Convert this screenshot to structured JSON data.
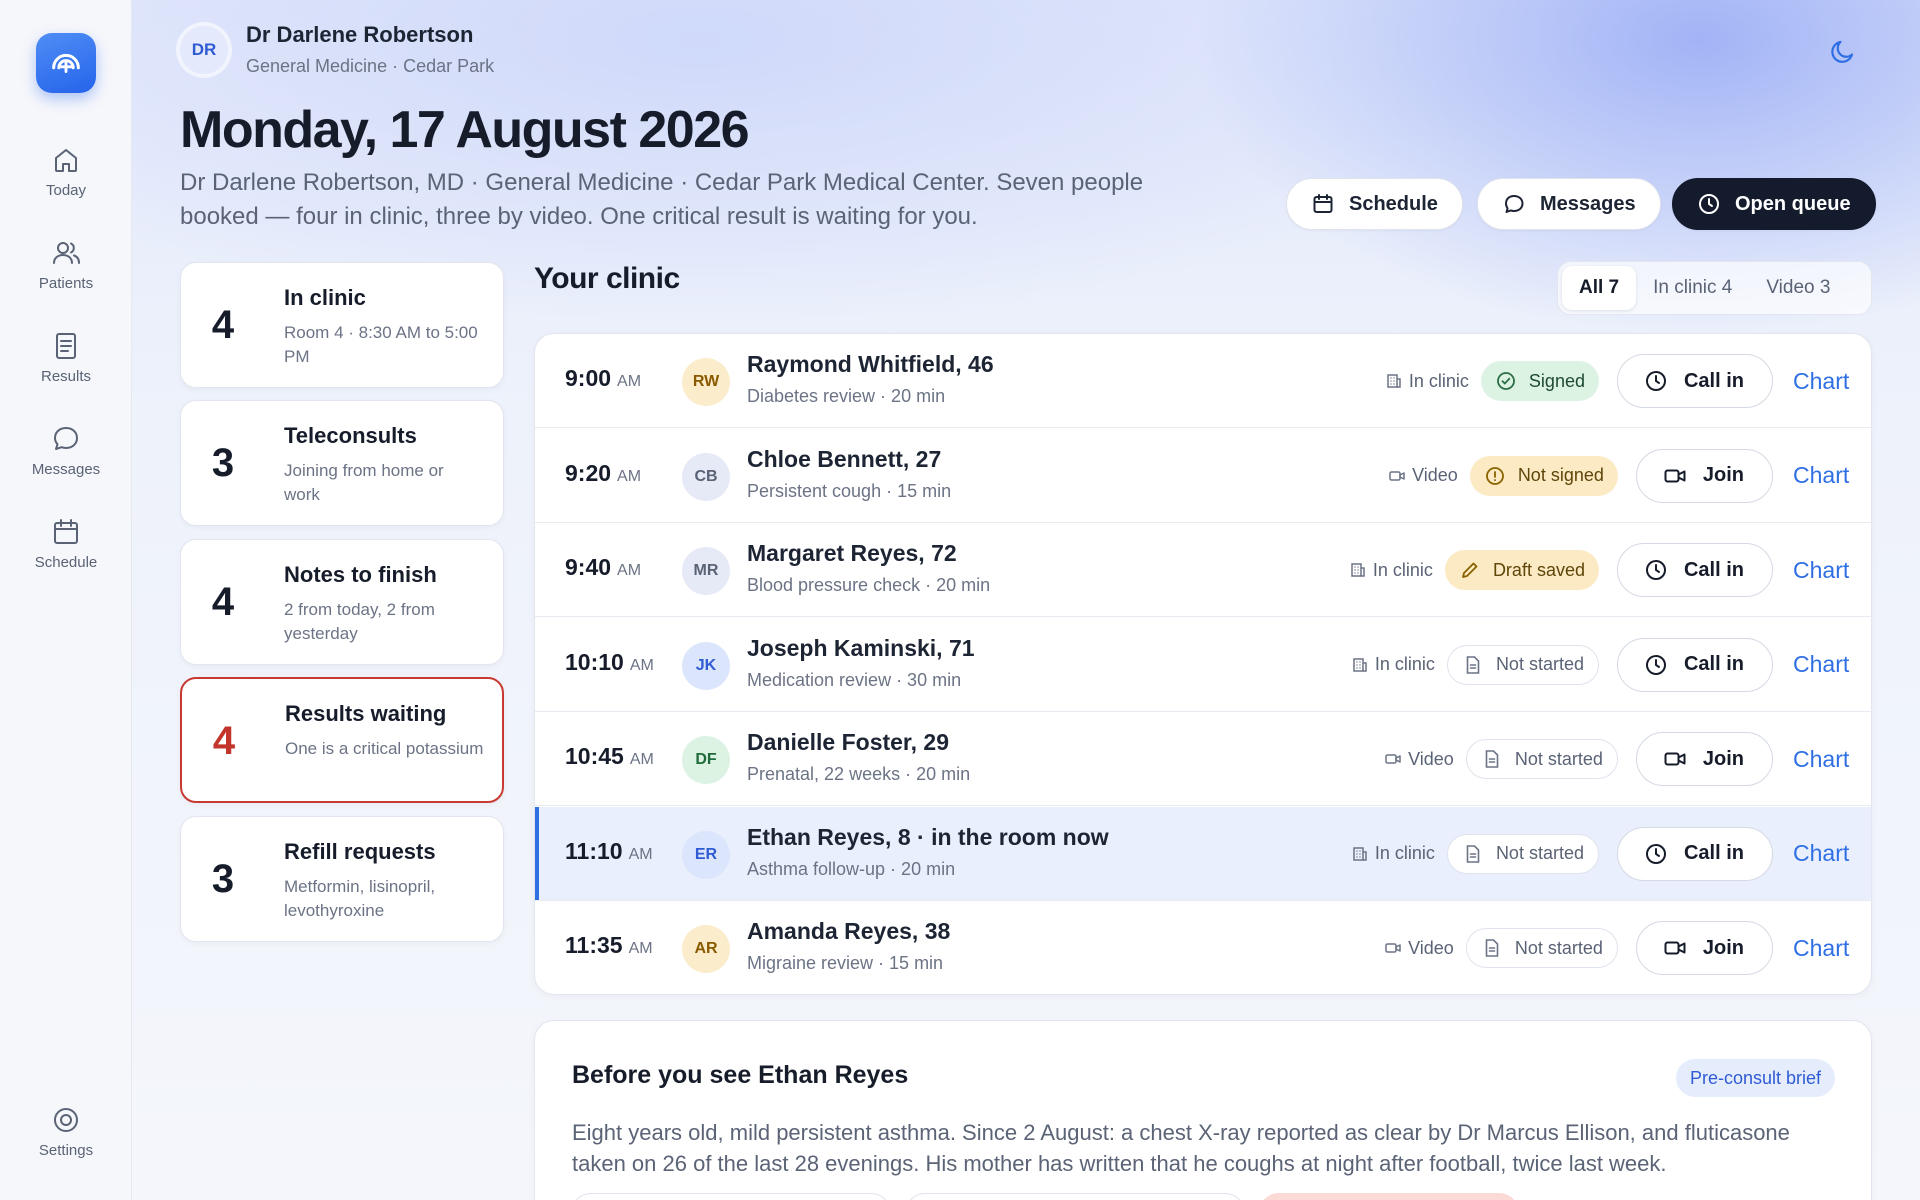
{
  "sidebar": {
    "items": [
      {
        "label": "Today",
        "icon": "home-icon"
      },
      {
        "label": "Patients",
        "icon": "users-icon"
      },
      {
        "label": "Results",
        "icon": "document-icon"
      },
      {
        "label": "Messages",
        "icon": "chat-icon"
      },
      {
        "label": "Schedule",
        "icon": "calendar-icon"
      }
    ],
    "settings_label": "Settings"
  },
  "header": {
    "avatar_initials": "DR",
    "name": "Dr Darlene Robertson",
    "subtitle": "General Medicine · Cedar Park",
    "date": "Monday, 17 August 2026",
    "summary": "Dr Darlene Robertson, MD · General Medicine · Cedar Park Medical Center. Seven people booked — four in clinic, three by video. One critical result is waiting for you.",
    "buttons": {
      "schedule": "Schedule",
      "messages": "Messages",
      "open_queue": "Open queue"
    }
  },
  "stats": [
    {
      "count": "4",
      "title": "In clinic",
      "desc": "Room 4 · 8:30 AM to 5:00 PM"
    },
    {
      "count": "3",
      "title": "Teleconsults",
      "desc": "Joining from home or work"
    },
    {
      "count": "4",
      "title": "Notes to finish",
      "desc": "2 from today, 2 from yesterday"
    },
    {
      "count": "4",
      "title": "Results waiting",
      "desc": "One is a critical potassium"
    },
    {
      "count": "3",
      "title": "Refill requests",
      "desc": "Metformin, lisinopril, levothyroxine"
    }
  ],
  "clinic": {
    "title": "Your clinic",
    "filters": [
      "All 7",
      "In clinic 4",
      "Video 3"
    ],
    "appointments": [
      {
        "time": "9:00",
        "ampm": "AM",
        "initials": "RW",
        "name": "Raymond Whitfield, 46",
        "desc": "Diabetes review · 20 min",
        "mode": "In clinic",
        "status": "Signed",
        "action": "Call in",
        "chart": "Chart"
      },
      {
        "time": "9:20",
        "ampm": "AM",
        "initials": "CB",
        "name": "Chloe Bennett, 27",
        "desc": "Persistent cough · 15 min",
        "mode": "Video",
        "status": "Not signed",
        "action": "Join",
        "chart": "Chart"
      },
      {
        "time": "9:40",
        "ampm": "AM",
        "initials": "MR",
        "name": "Margaret Reyes, 72",
        "desc": "Blood pressure check · 20 min",
        "mode": "In clinic",
        "status": "Draft saved",
        "action": "Call in",
        "chart": "Chart"
      },
      {
        "time": "10:10",
        "ampm": "AM",
        "initials": "JK",
        "name": "Joseph Kaminski, 71",
        "desc": "Medication review · 30 min",
        "mode": "In clinic",
        "status": "Not started",
        "action": "Call in",
        "chart": "Chart"
      },
      {
        "time": "10:45",
        "ampm": "AM",
        "initials": "DF",
        "name": "Danielle Foster, 29",
        "desc": "Prenatal, 22 weeks · 20 min",
        "mode": "Video",
        "status": "Not started",
        "action": "Join",
        "chart": "Chart"
      },
      {
        "time": "11:10",
        "ampm": "AM",
        "initials": "ER",
        "name": "Ethan Reyes, 8 · in the room now",
        "desc": "Asthma follow-up · 20 min",
        "mode": "In clinic",
        "status": "Not started",
        "action": "Call in",
        "chart": "Chart"
      },
      {
        "time": "11:35",
        "ampm": "AM",
        "initials": "AR",
        "name": "Amanda Reyes, 38",
        "desc": "Migraine review · 15 min",
        "mode": "Video",
        "status": "Not started",
        "action": "Join",
        "chart": "Chart"
      }
    ]
  },
  "brief": {
    "title": "Before you see Ethan Reyes",
    "tag": "Pre-consult brief",
    "text": "Eight years old, mild persistent asthma. Since 2 August: a chest X-ray reported as clear by Dr Marcus Ellison, and fluticas­one taken on 26 of the last 28 evenings. His mother has written that he coughs at night after football, twice last week."
  },
  "colors": {
    "accent": "#2f6fe4",
    "dark_button": "#141b2d",
    "alert_border": "#c83a31",
    "signed_bg": "#dcf3e4",
    "warning_bg": "#fbeac4"
  }
}
